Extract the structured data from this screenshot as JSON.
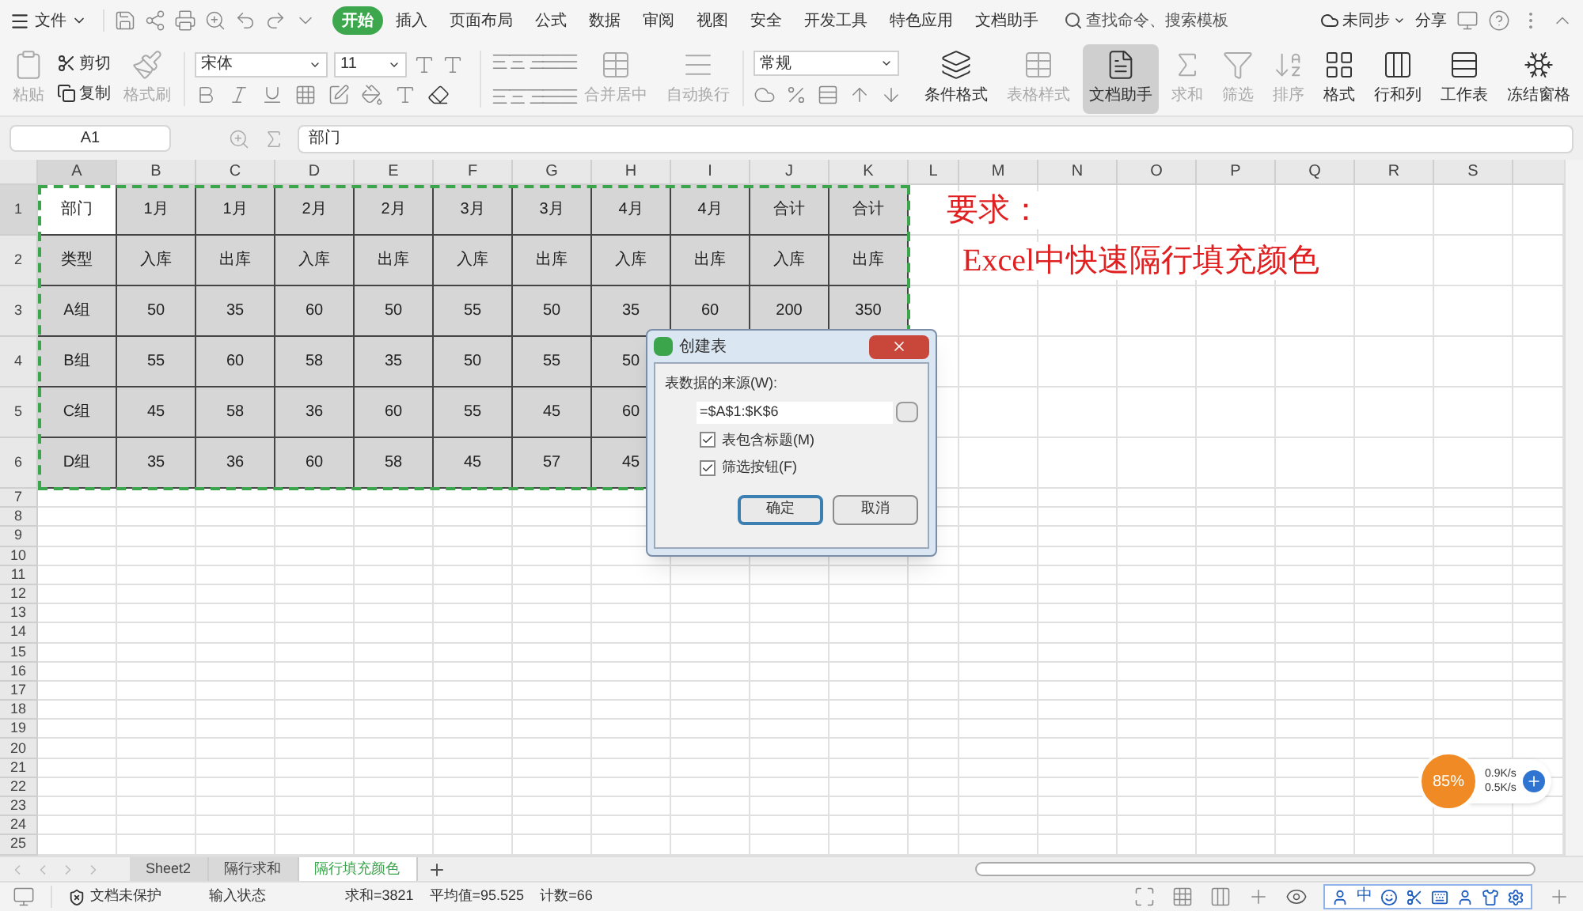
{
  "menu_bar": {
    "file": "文件",
    "tabs": [
      {
        "label": "开始",
        "selected": true
      },
      {
        "label": "插入",
        "selected": false
      },
      {
        "label": "页面布局",
        "selected": false
      },
      {
        "label": "公式",
        "selected": false
      },
      {
        "label": "数据",
        "selected": false
      },
      {
        "label": "审阅",
        "selected": false
      },
      {
        "label": "视图",
        "selected": false
      },
      {
        "label": "安全",
        "selected": false
      },
      {
        "label": "开发工具",
        "selected": false
      },
      {
        "label": "特色应用",
        "selected": false
      },
      {
        "label": "文档助手",
        "selected": false
      }
    ],
    "search": "查找命令、搜索模板",
    "sync": "未同步",
    "share": "分享"
  },
  "toolbar": {
    "clipboard": [
      {
        "label": "粘贴",
        "disabled": true
      },
      {
        "label": "剪切",
        "disabled": false
      },
      {
        "label": "复制",
        "disabled": false
      },
      {
        "label": "格式刷",
        "disabled": true
      }
    ],
    "font": {
      "name": "宋体",
      "size": "11"
    },
    "cells": [
      {
        "label": "合并居中",
        "disabled": true
      },
      {
        "label": "自动换行",
        "disabled": true
      }
    ],
    "number_format": "常规",
    "tools": [
      {
        "label": "条件格式",
        "disabled": false,
        "selected": false
      },
      {
        "label": "表格样式",
        "disabled": true,
        "selected": false
      },
      {
        "label": "文档助手",
        "disabled": false,
        "selected": true
      },
      {
        "label": "求和",
        "disabled": true,
        "selected": false
      },
      {
        "label": "筛选",
        "disabled": true,
        "selected": false
      },
      {
        "label": "排序",
        "disabled": true,
        "selected": false
      },
      {
        "label": "格式",
        "disabled": false,
        "selected": false
      },
      {
        "label": "行和列",
        "disabled": false,
        "selected": false
      },
      {
        "label": "工作表",
        "disabled": false,
        "selected": false
      },
      {
        "label": "冻结窗格",
        "disabled": false,
        "selected": false
      }
    ]
  },
  "formula_bar": {
    "cell_ref": "A1",
    "value": "部门"
  },
  "sheet": {
    "columns": [
      "A",
      "B",
      "C",
      "D",
      "E",
      "F",
      "G",
      "H",
      "I",
      "J",
      "K",
      "L",
      "M",
      "N",
      "O",
      "P",
      "Q",
      "R",
      "S"
    ],
    "row_numbers": [
      "1",
      "2",
      "3",
      "4",
      "5",
      "6",
      "7",
      "8",
      "9",
      "10",
      "11",
      "12",
      "13",
      "14",
      "15",
      "16",
      "17",
      "18",
      "19",
      "20",
      "21",
      "22",
      "23",
      "24",
      "25"
    ],
    "table": {
      "rows": [
        [
          {
            "text": "部门",
            "selected": true
          },
          {
            "text": "1月",
            "selected": false
          },
          {
            "text": "1月",
            "selected": false
          },
          {
            "text": "2月",
            "selected": false
          },
          {
            "text": "2月",
            "selected": false
          },
          {
            "text": "3月",
            "selected": false
          },
          {
            "text": "3月",
            "selected": false
          },
          {
            "text": "4月",
            "selected": false
          },
          {
            "text": "4月",
            "selected": false
          },
          {
            "text": "合计",
            "selected": false
          },
          {
            "text": "合计",
            "selected": false
          }
        ],
        [
          {
            "text": "类型",
            "selected": false
          },
          {
            "text": "入库",
            "selected": false
          },
          {
            "text": "出库",
            "selected": false
          },
          {
            "text": "入库",
            "selected": false
          },
          {
            "text": "出库",
            "selected": false
          },
          {
            "text": "入库",
            "selected": false
          },
          {
            "text": "出库",
            "selected": false
          },
          {
            "text": "入库",
            "selected": false
          },
          {
            "text": "出库",
            "selected": false
          },
          {
            "text": "入库",
            "selected": false
          },
          {
            "text": "出库",
            "selected": false
          }
        ],
        [
          {
            "text": "A组",
            "selected": false
          },
          {
            "text": "50",
            "selected": false
          },
          {
            "text": "35",
            "selected": false
          },
          {
            "text": "60",
            "selected": false
          },
          {
            "text": "50",
            "selected": false
          },
          {
            "text": "55",
            "selected": false
          },
          {
            "text": "50",
            "selected": false
          },
          {
            "text": "35",
            "selected": false
          },
          {
            "text": "60",
            "selected": false
          },
          {
            "text": "200",
            "selected": false
          },
          {
            "text": "350",
            "selected": false
          }
        ],
        [
          {
            "text": "B组",
            "selected": false
          },
          {
            "text": "55",
            "selected": false
          },
          {
            "text": "60",
            "selected": false
          },
          {
            "text": "58",
            "selected": false
          },
          {
            "text": "35",
            "selected": false
          },
          {
            "text": "50",
            "selected": false
          },
          {
            "text": "55",
            "selected": false
          },
          {
            "text": "50",
            "selected": false
          }
        ],
        [
          {
            "text": "C组",
            "selected": false
          },
          {
            "text": "45",
            "selected": false
          },
          {
            "text": "58",
            "selected": false
          },
          {
            "text": "36",
            "selected": false
          },
          {
            "text": "60",
            "selected": false
          },
          {
            "text": "55",
            "selected": false
          },
          {
            "text": "45",
            "selected": false
          },
          {
            "text": "60",
            "selected": false
          }
        ],
        [
          {
            "text": "D组",
            "selected": false
          },
          {
            "text": "35",
            "selected": false
          },
          {
            "text": "36",
            "selected": false
          },
          {
            "text": "60",
            "selected": false
          },
          {
            "text": "58",
            "selected": false
          },
          {
            "text": "45",
            "selected": false
          },
          {
            "text": "57",
            "selected": false
          },
          {
            "text": "45",
            "selected": false
          }
        ]
      ]
    },
    "notes": [
      "要求：",
      "Excel中快速隔行填充颜色"
    ]
  },
  "dialog": {
    "title": "创建表",
    "source_label": "表数据的来源(W):",
    "source_value": "=$A$1:$K$6",
    "options": [
      {
        "label": "表包含标题(M)",
        "checked": true
      },
      {
        "label": "筛选按钮(F)",
        "checked": true
      }
    ],
    "buttons": [
      {
        "label": "确定",
        "default": true
      },
      {
        "label": "取消",
        "default": false
      }
    ]
  },
  "sheet_tabs": [
    {
      "label": "Sheet2",
      "selected": false
    },
    {
      "label": "隔行求和",
      "selected": false
    },
    {
      "label": "隔行填充颜色",
      "selected": true
    }
  ],
  "status_bar": {
    "protection": "文档未保护",
    "mode": "输入状态",
    "sum": "求和=3821",
    "average": "平均值=95.525",
    "count": "计数=66",
    "ime": "中"
  },
  "net_widget": {
    "percent": "85%",
    "upload": "0.9K/s",
    "download": "0.5K/s"
  }
}
